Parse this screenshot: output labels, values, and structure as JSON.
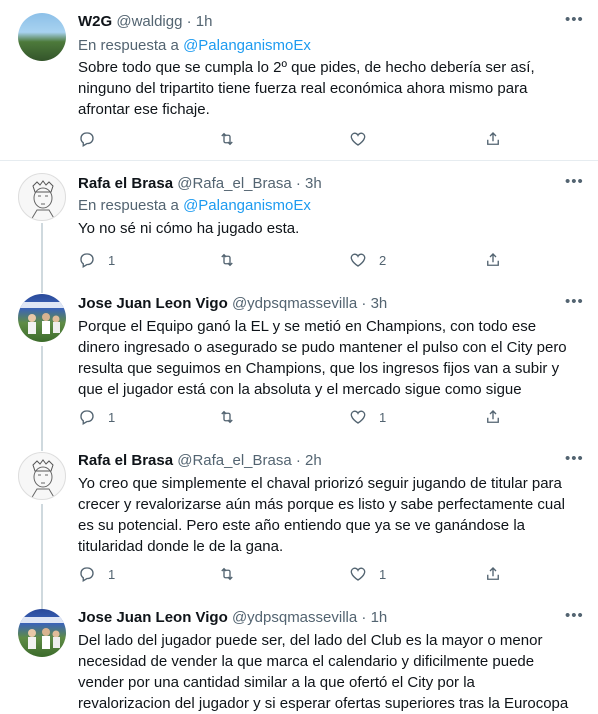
{
  "icons": {
    "more": "more-horizontal-icon",
    "reply": "reply-icon",
    "retweet": "retweet-icon",
    "like": "heart-icon",
    "share": "share-icon"
  },
  "colors": {
    "link": "#1d9bf0",
    "secondary": "#536471",
    "text": "#0f1419",
    "divider": "#e6ecf0"
  },
  "tweets": [
    {
      "name": "W2G",
      "handle": "@waldigg",
      "time": "1h",
      "reply_prefix": "En respuesta a",
      "reply_to": "@PalanganismoEx",
      "text": "Sobre todo que se cumpla lo 2º que pides, de hecho debería ser así, ninguno del tripartito tiene fuerza real económica ahora mismo para afrontar ese fichaje.",
      "replies": "",
      "likes": ""
    },
    {
      "name": "Rafa el Brasa",
      "handle": "@Rafa_el_Brasa",
      "time": "3h",
      "reply_prefix": "En respuesta a",
      "reply_to": "@PalanganismoEx",
      "text": "Yo no sé ni cómo ha jugado esta.",
      "replies": "1",
      "likes": "2"
    },
    {
      "name": "Jose Juan Leon Vigo",
      "handle": "@ydpsqmassevilla",
      "time": "3h",
      "text": "Porque el Equipo ganó la EL y se metió en Champions, con todo ese dinero ingresado o asegurado se pudo mantener el pulso con el City pero resulta que seguimos en Champions, que los ingresos fijos van a subir y que el jugador está con la absoluta y el mercado sigue como sigue",
      "replies": "1",
      "likes": "1"
    },
    {
      "name": "Rafa el Brasa",
      "handle": "@Rafa_el_Brasa",
      "time": "2h",
      "text": "Yo creo que simplemente el chaval priorizó seguir jugando de titular para crecer y revalorizarse aún más porque es listo y sabe perfectamente cual es su potencial. Pero este año entiendo que ya se ve ganándose la titularidad donde le de la gana.",
      "replies": "1",
      "likes": "1"
    },
    {
      "name": "Jose Juan Leon Vigo",
      "handle": "@ydpsqmassevilla",
      "time": "1h",
      "text": "Del lado del jugador puede ser, del lado del Club es la mayor o menor necesidad de vender la que marca el calendario y dificilmente puede vender por una cantidad similar a la que ofertó el City por la revalorizacion del jugador y si esperar ofertas superiores tras la Eurocopa"
    }
  ]
}
